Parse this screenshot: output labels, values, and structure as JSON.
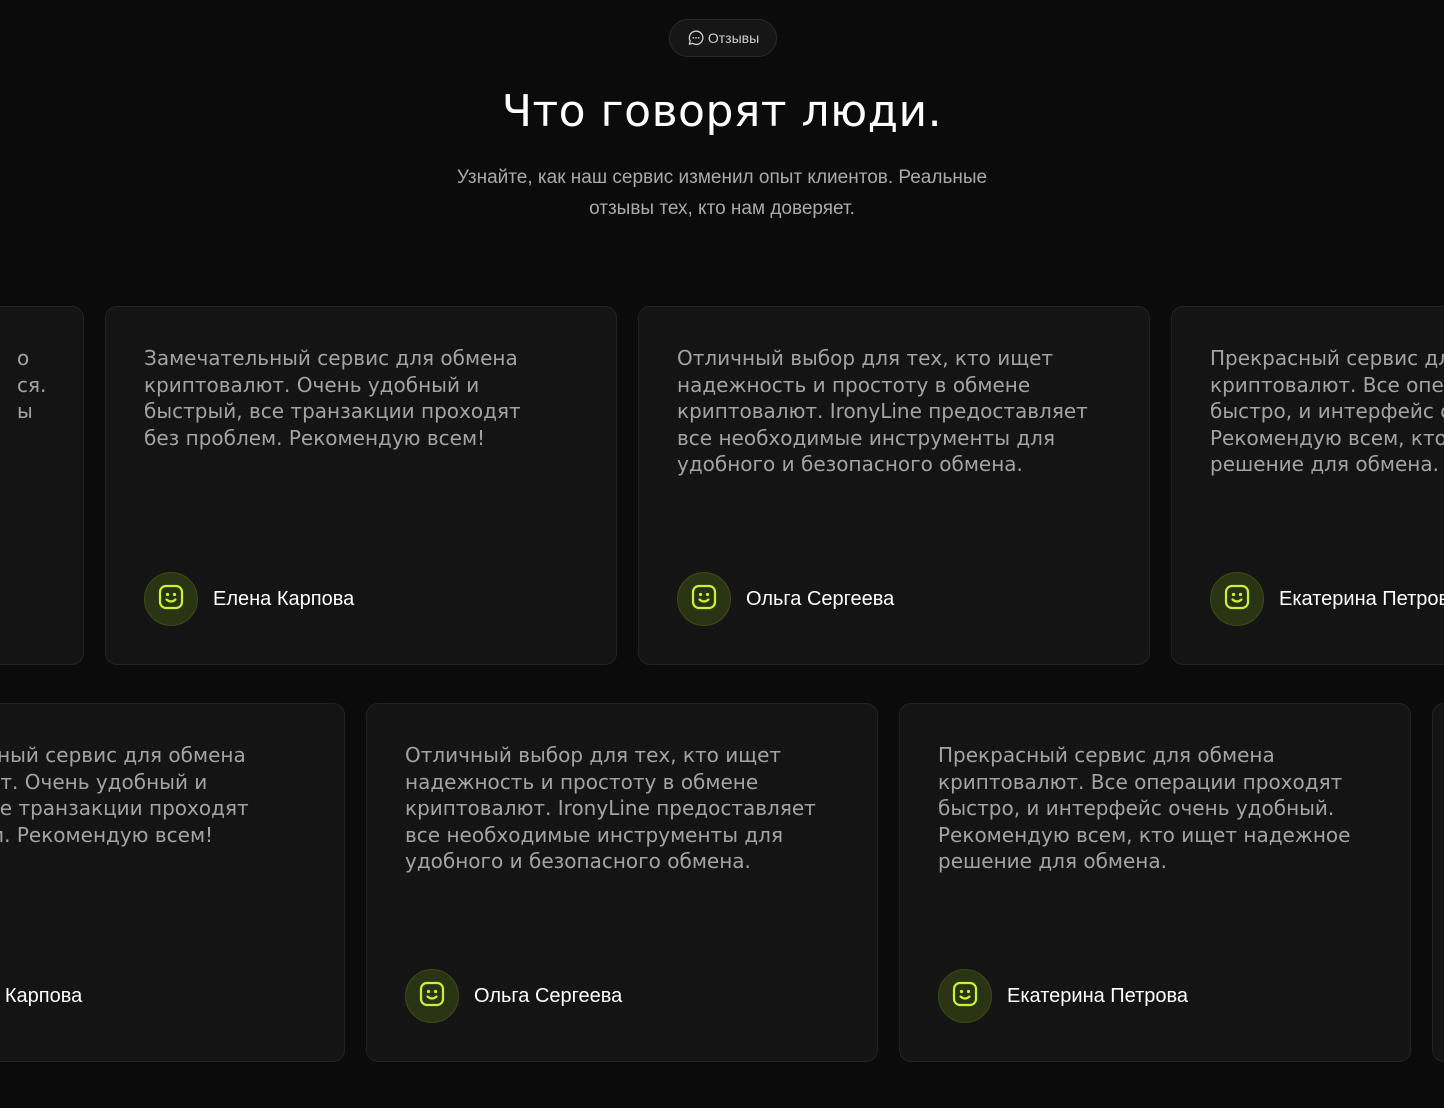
{
  "section": {
    "badge_label": "Отзывы",
    "title": "Что говорят люди.",
    "subtitle": "Узнайте, как наш сервис изменил опыт клиентов. Реальные отзывы тех, кто нам доверяет."
  },
  "colors": {
    "background": "#0b0b0b",
    "card_background": "#141414",
    "accent": "#c6f432",
    "avatar_background": "#2b3412"
  },
  "icons": {
    "badge": "chat-bubble-icon",
    "avatar": "smiley-icon"
  },
  "rows": [
    {
      "cards": [
        {
          "visible_text": "о\nся.\nы",
          "author": ""
        },
        {
          "text": "Замечательный сервис для обмена\nкриптовалют. Очень удобный и\nбыстрый, все транзакции проходят\nбез проблем. Рекомендую всем!",
          "author": "Елена Карпова"
        },
        {
          "text": "Отличный выбор для тех, кто ищет\nнадежность и простоту в обмене\nкриптовалют. IronyLine предоставляет\nвсе необходимые инструменты для\nудобного и безопасного обмена.",
          "author": "Ольга Сергеева"
        },
        {
          "text": "Прекрасный сервис для обмена\nкриптовалют. Все операции проходят\nбыстро, и интерфейс очень удобный.\nРекомендую всем, кто ищет надежное\nрешение для обмена.",
          "author": "Екатерина Петрова"
        }
      ]
    },
    {
      "cards": [
        {
          "text": "Замечательный сервис для обмена\nкриптовалют. Очень удобный и\nбыстрый, все транзакции проходят\nбез проблем. Рекомендую всем!",
          "author": "Елена Карпова"
        },
        {
          "text": "Отличный выбор для тех, кто ищет\nнадежность и простоту в обмене\nкриптовалют. IronyLine предоставляет\nвсе необходимые инструменты для\nудобного и безопасного обмена.",
          "author": "Ольга Сергеева"
        },
        {
          "text": "Прекрасный сервис для обмена\nкриптовалют. Все операции проходят\nбыстро, и интерфейс очень удобный.\nРекомендую всем, кто ищет надежное\nрешение для обмена.",
          "author": "Екатерина Петрова"
        },
        {
          "text": "",
          "author": ""
        }
      ]
    }
  ]
}
